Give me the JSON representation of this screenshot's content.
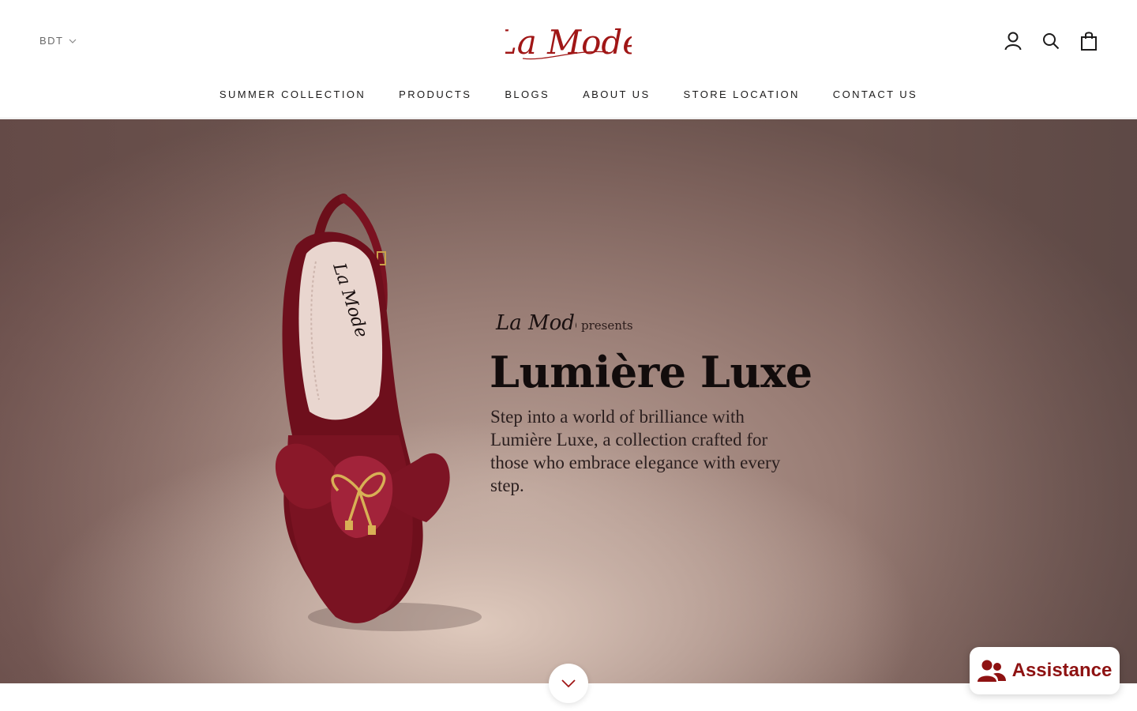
{
  "header": {
    "currency": "BDT",
    "logo_text": "La Mode",
    "icons": [
      "account-icon",
      "search-icon",
      "cart-icon"
    ]
  },
  "nav": {
    "items": [
      {
        "label": "SUMMER COLLECTION"
      },
      {
        "label": "PRODUCTS"
      },
      {
        "label": "BLOGS"
      },
      {
        "label": "ABOUT US"
      },
      {
        "label": "STORE LOCATION"
      },
      {
        "label": "CONTACT US"
      }
    ]
  },
  "hero": {
    "brand": "La Mode",
    "presents": "presents",
    "title": "Lumière Luxe",
    "description": "Step into a world of brilliance with Lumière Luxe, a collection crafted for those who embrace elegance with every step.",
    "shoe_logo": "La Mode"
  },
  "assistant": {
    "label": "Assistance"
  },
  "colors": {
    "brand_red": "#a01616",
    "assist_red": "#8e1212",
    "text_dark": "#1c1b1b",
    "hero_bg": "#9a7e76"
  }
}
